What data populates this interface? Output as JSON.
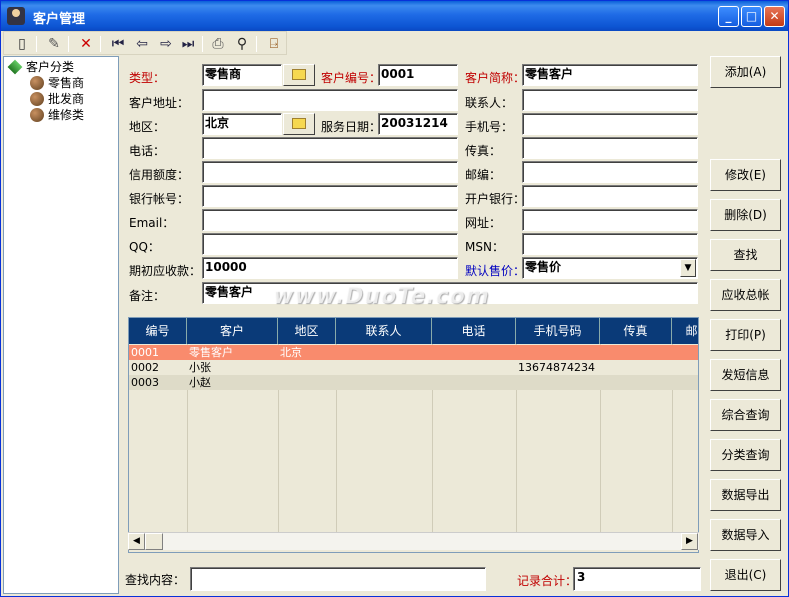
{
  "window": {
    "title": "客户管理"
  },
  "title_buttons": {
    "minimize": "_",
    "maximize": "□",
    "close": "✕"
  },
  "toolbar": {
    "icons": [
      "new-document-icon",
      "edit-icon",
      "delete-icon",
      "first-record-icon",
      "previous-icon",
      "next-icon",
      "last-record-icon",
      "print-icon",
      "find-icon",
      "exit-door-icon"
    ]
  },
  "tree": {
    "root": "客户分类",
    "items": [
      "零售商",
      "批发商",
      "维修类"
    ]
  },
  "form": {
    "type_label": "类型：",
    "type_value": "零售商",
    "code_label": "客户编号：",
    "code_value": "0001",
    "short_name_label": "客户简称：",
    "short_name_value": "零售客户",
    "address_label": "客户地址：",
    "address_value": "",
    "contact_label": "联系人：",
    "contact_value": "",
    "region_label": "地区：",
    "region_value": "北京",
    "service_date_label": "服务日期：",
    "service_date_value": "20031214",
    "mobile_label": "手机号：",
    "mobile_value": "",
    "phone_label": "电话：",
    "phone_value": "",
    "fax_label": "传真：",
    "fax_value": "",
    "credit_label": "信用额度：",
    "credit_value": "",
    "zip_label": "邮编：",
    "zip_value": "",
    "bank_acct_label": "银行帐号：",
    "bank_acct_value": "",
    "bank_label": "开户银行：",
    "bank_value": "",
    "email_label": "Email：",
    "email_value": "",
    "website_label": "网址：",
    "website_value": "",
    "qq_label": "QQ：",
    "qq_value": "",
    "msn_label": "MSN：",
    "msn_value": "",
    "opening_recv_label": "期初应收款：",
    "opening_recv_value": "10000",
    "default_price_label": "默认售价：",
    "default_price_value": "零售价",
    "note_label": "备注：",
    "note_value": "零售客户"
  },
  "grid": {
    "columns": [
      "编号",
      "客户",
      "地区",
      "联系人",
      "电话",
      "手机号码",
      "传真",
      "邮"
    ],
    "rows": [
      [
        "0001",
        "零售客户",
        "北京",
        "",
        "",
        "",
        "",
        ""
      ],
      [
        "0002",
        "小张",
        "",
        "",
        "",
        "13674874234",
        "",
        ""
      ],
      [
        "0003",
        "小赵",
        "",
        "",
        "",
        "",
        "",
        ""
      ]
    ]
  },
  "side_buttons": [
    "添加(A)",
    "修改(E)",
    "删除(D)",
    "查找",
    "应收总帐",
    "打印(P)",
    "发短信息",
    "综合查询",
    "分类查询",
    "数据导出",
    "数据导入",
    "退出(C)"
  ],
  "footer": {
    "search_label": "查找内容：",
    "search_value": "",
    "count_label": "记录合计：",
    "count_value": "3"
  },
  "watermark": "www.DuoTe.com",
  "colors": {
    "title_bar": "#0a5fd8",
    "selected_row": "#f98b6d",
    "grid_header": "#0a3a78",
    "required_label": "#c00000"
  }
}
